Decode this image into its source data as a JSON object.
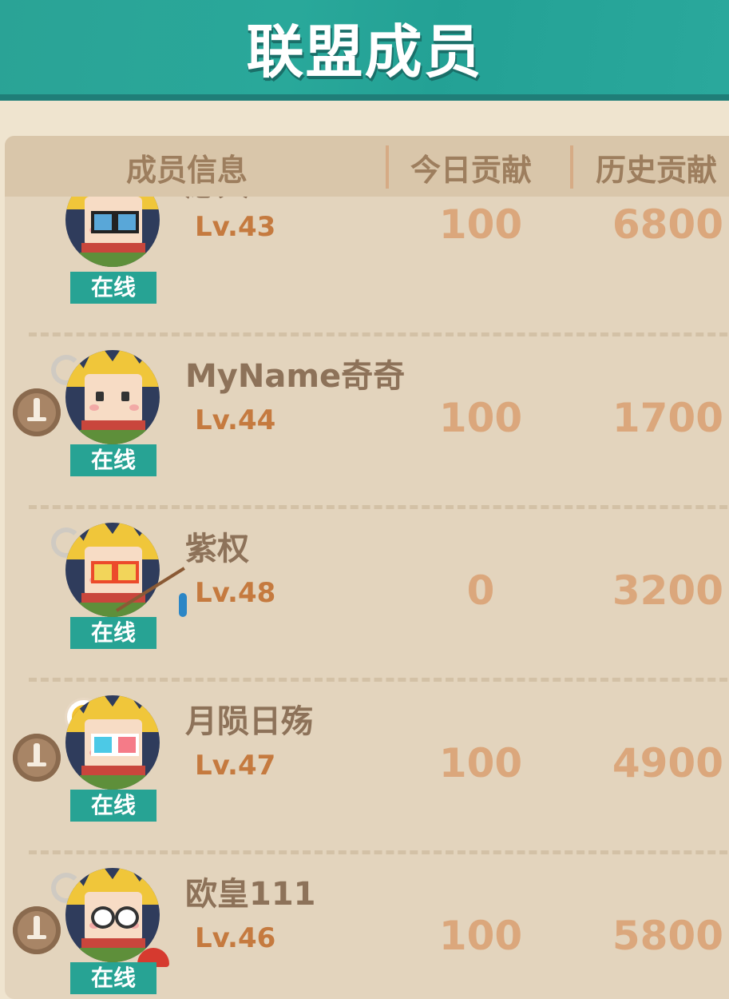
{
  "title": "联盟成员",
  "columns": {
    "info": "成员信息",
    "today": "今日贡献",
    "history": "历史贡献"
  },
  "members": [
    {
      "name": "愿大",
      "level": "Lv.43",
      "status": "在线",
      "today": "100",
      "history": "6800",
      "badge": false,
      "glasses": "blue"
    },
    {
      "name": "MyName奇奇",
      "level": "Lv.44",
      "status": "在线",
      "today": "100",
      "history": "1700",
      "badge": true,
      "glasses": "none"
    },
    {
      "name": "紫权",
      "level": "Lv.48",
      "status": "在线",
      "today": "0",
      "history": "3200",
      "badge": false,
      "glasses": "heart-red"
    },
    {
      "name": "月陨日殇",
      "level": "Lv.47",
      "status": "在线",
      "today": "100",
      "history": "4900",
      "badge": true,
      "glasses": "3d"
    },
    {
      "name": "欧皇111",
      "level": "Lv.46",
      "status": "在线",
      "today": "100",
      "history": "5800",
      "badge": true,
      "glasses": "spiral"
    }
  ],
  "icons": {
    "badge": "sword-badge-icon",
    "avatar": "player-avatar",
    "emote": "dizzy-emote-icon"
  },
  "colors": {
    "title_bar": "#2aa396",
    "online_tag": "#27a394",
    "level_text": "#c57a3f",
    "value_text": "#dba77c",
    "name_text": "#8d7259"
  }
}
